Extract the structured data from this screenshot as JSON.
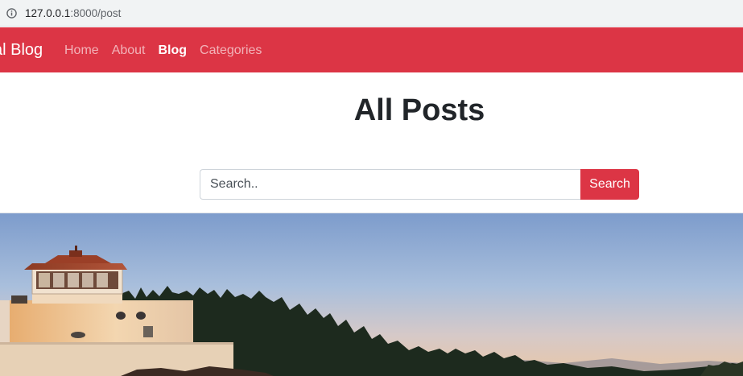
{
  "browser": {
    "url_host": "127.0.0.1",
    "url_rest": ":8000/post",
    "info_icon": "info-icon"
  },
  "navbar": {
    "brand": "al Blog",
    "links": [
      {
        "label": "Home",
        "active": false
      },
      {
        "label": "About",
        "active": false
      },
      {
        "label": "Blog",
        "active": true
      },
      {
        "label": "Categories",
        "active": false
      }
    ],
    "color": "#dc3545"
  },
  "main": {
    "title": "All Posts"
  },
  "search": {
    "placeholder": "Search..",
    "button_label": "Search"
  },
  "hero": {
    "image": "lighthouse-sunset-photo"
  }
}
